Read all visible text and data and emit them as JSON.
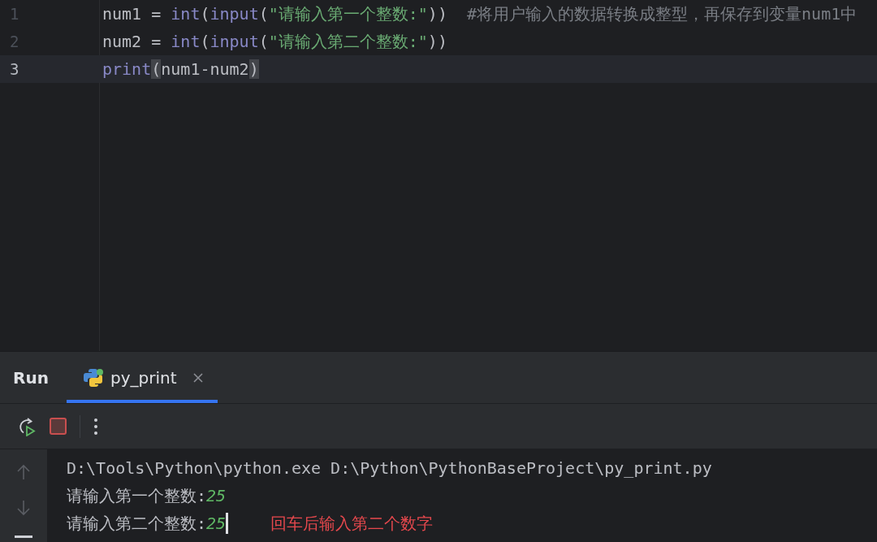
{
  "editor": {
    "lines": [
      {
        "number": "1",
        "current": false,
        "tokens": [
          {
            "kind": "plain",
            "text": "num1 = "
          },
          {
            "kind": "builtin",
            "text": "int"
          },
          {
            "kind": "plain",
            "text": "("
          },
          {
            "kind": "builtin",
            "text": "input"
          },
          {
            "kind": "plain",
            "text": "("
          },
          {
            "kind": "string",
            "text": "\"请输入第一个整数:\""
          },
          {
            "kind": "plain",
            "text": "))  "
          },
          {
            "kind": "comment",
            "text": "#将用户输入的数据转换成整型，再保存到变量num1中"
          }
        ]
      },
      {
        "number": "2",
        "current": false,
        "tokens": [
          {
            "kind": "plain",
            "text": "num2 = "
          },
          {
            "kind": "builtin",
            "text": "int"
          },
          {
            "kind": "plain",
            "text": "("
          },
          {
            "kind": "builtin",
            "text": "input"
          },
          {
            "kind": "plain",
            "text": "("
          },
          {
            "kind": "string",
            "text": "\"请输入第二个整数:\""
          },
          {
            "kind": "plain",
            "text": "))"
          }
        ]
      },
      {
        "number": "3",
        "current": true,
        "tokens": [
          {
            "kind": "builtin",
            "text": "print"
          },
          {
            "kind": "paren-match",
            "text": "("
          },
          {
            "kind": "plain",
            "text": "num1-num2"
          },
          {
            "kind": "paren-match",
            "text": ")"
          }
        ]
      }
    ]
  },
  "run_panel": {
    "title": "Run",
    "tabs": [
      {
        "label": "py_print",
        "selected": true,
        "closable": true
      }
    ],
    "console": {
      "lines": [
        {
          "kind": "command",
          "text": "D:\\Tools\\Python\\python.exe D:\\Python\\PythonBaseProject\\py_print.py"
        },
        {
          "kind": "prompt",
          "text": "请输入第一个整数:",
          "input": "25",
          "cursor": false
        },
        {
          "kind": "prompt",
          "text": "请输入第二个整数:",
          "input": "25",
          "cursor": true
        }
      ]
    },
    "annotation": "回车后输入第二个数字"
  }
}
